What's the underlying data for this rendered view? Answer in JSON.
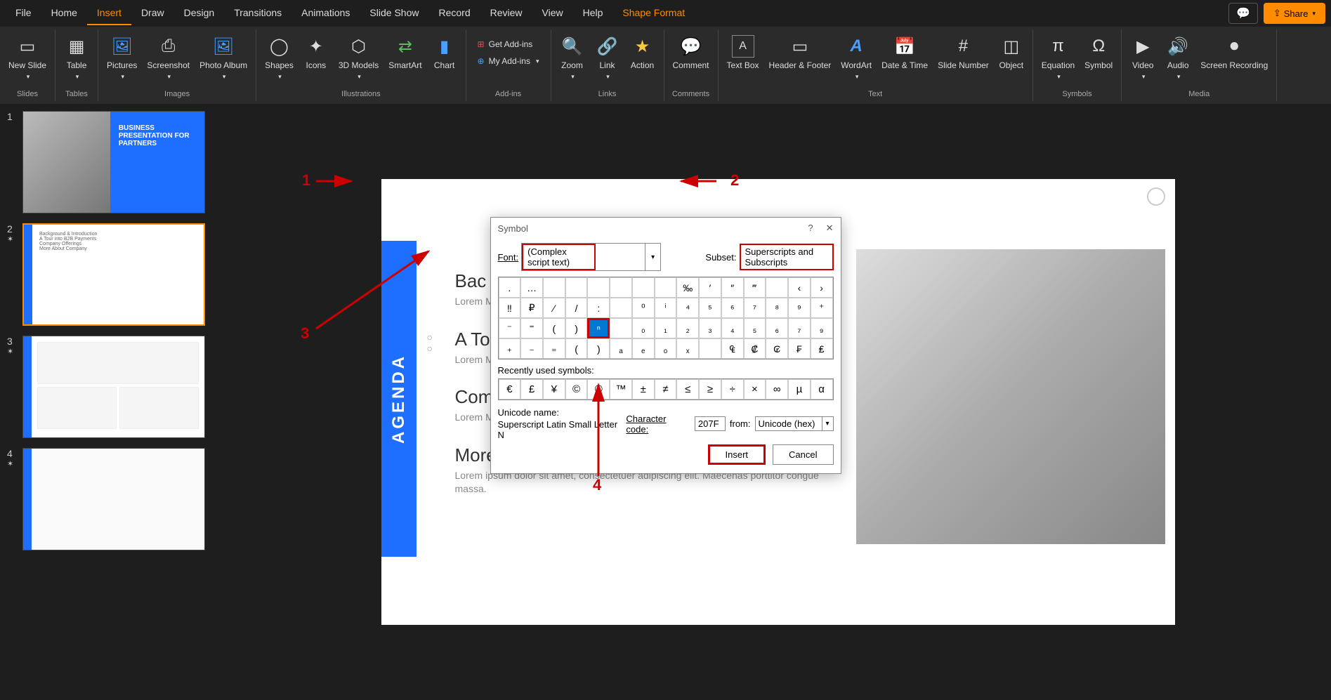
{
  "menu": {
    "items": [
      "File",
      "Home",
      "Insert",
      "Draw",
      "Design",
      "Transitions",
      "Animations",
      "Slide Show",
      "Record",
      "Review",
      "View",
      "Help",
      "Shape Format"
    ],
    "active": "Insert",
    "share": "Share"
  },
  "ribbon": {
    "groups": [
      {
        "label": "Slides",
        "buttons": [
          {
            "name": "New Slide",
            "icon": "▭⁺"
          }
        ]
      },
      {
        "label": "Tables",
        "buttons": [
          {
            "name": "Table",
            "icon": "▦"
          }
        ]
      },
      {
        "label": "Images",
        "buttons": [
          {
            "name": "Pictures",
            "icon": "🖼"
          },
          {
            "name": "Screenshot",
            "icon": "⎙"
          },
          {
            "name": "Photo Album",
            "icon": "🖼"
          }
        ]
      },
      {
        "label": "Illustrations",
        "buttons": [
          {
            "name": "Shapes",
            "icon": "○"
          },
          {
            "name": "Icons",
            "icon": "✦"
          },
          {
            "name": "3D Models",
            "icon": "⬢"
          },
          {
            "name": "SmartArt",
            "icon": "⇄"
          },
          {
            "name": "Chart",
            "icon": "📊"
          }
        ]
      },
      {
        "label": "Add-ins",
        "small": [
          {
            "name": "Get Add-ins",
            "icon": "⊞"
          },
          {
            "name": "My Add-ins",
            "icon": "⊕"
          }
        ]
      },
      {
        "label": "Links",
        "buttons": [
          {
            "name": "Zoom",
            "icon": "🔍"
          },
          {
            "name": "Link",
            "icon": "🔗"
          },
          {
            "name": "Action",
            "icon": "★"
          }
        ]
      },
      {
        "label": "Comments",
        "buttons": [
          {
            "name": "Comment",
            "icon": "💬"
          }
        ]
      },
      {
        "label": "Text",
        "buttons": [
          {
            "name": "Text Box",
            "icon": "A"
          },
          {
            "name": "Header & Footer",
            "icon": "▭"
          },
          {
            "name": "WordArt",
            "icon": "A"
          },
          {
            "name": "Date & Time",
            "icon": "📅"
          },
          {
            "name": "Slide Number",
            "icon": "#"
          },
          {
            "name": "Object",
            "icon": "◫"
          }
        ]
      },
      {
        "label": "Symbols",
        "buttons": [
          {
            "name": "Equation",
            "icon": "π"
          },
          {
            "name": "Symbol",
            "icon": "Ω"
          }
        ]
      },
      {
        "label": "Media",
        "buttons": [
          {
            "name": "Video",
            "icon": "▶"
          },
          {
            "name": "Audio",
            "icon": "🔊"
          },
          {
            "name": "Screen Recording",
            "icon": "⏺"
          }
        ]
      }
    ]
  },
  "slides_panel": {
    "thumbs": [
      {
        "num": "1",
        "star": false,
        "title": "BUSINESS PRESENTATION FOR PARTNERS"
      },
      {
        "num": "2",
        "star": true,
        "selected": true,
        "items": [
          "Background & Introduction",
          "A Tour into B2B Payments",
          "Company Offerings",
          "More About Company"
        ]
      },
      {
        "num": "3",
        "star": true
      },
      {
        "num": "4",
        "star": true
      }
    ]
  },
  "slide": {
    "agenda_label": "AGENDA",
    "sections": [
      {
        "title": "Bac",
        "text": "Lorem\nMaece"
      },
      {
        "title": "A To",
        "text": "Lorem\nMaece"
      },
      {
        "title": "Com",
        "text": "Lorem\nMaecenas porttitor congue massa."
      },
      {
        "title": "More About Company",
        "text": "Lorem ipsum dolor sit amet, consectetuer adipiscing elit.\nMaecenas porttitor congue massa."
      }
    ]
  },
  "dialog": {
    "title": "Symbol",
    "font_label": "Font:",
    "font_value": "(Complex script text)",
    "subset_label": "Subset:",
    "subset_value": "Superscripts and Subscripts",
    "grid": [
      [
        ".",
        "…",
        "",
        "",
        "",
        "",
        "",
        "",
        "‰",
        "′",
        "″",
        "‴",
        "",
        "‹",
        "›"
      ],
      [
        "‼",
        "₽",
        "⁄",
        "/",
        ":",
        "",
        "⁰",
        "ⁱ",
        "⁴",
        "⁵",
        "⁶",
        "⁷",
        "⁸",
        "⁹",
        "⁺"
      ],
      [
        "⁻",
        "⁼",
        "(",
        ")",
        "ⁿ",
        "",
        "₀",
        "₁",
        "₂",
        "₃",
        "₄",
        "₅",
        "₆",
        "₇",
        "₉"
      ],
      [
        "₊",
        "₋",
        "₌",
        "(",
        ")",
        "ₐ",
        "ₑ",
        "ₒ",
        "ₓ",
        "",
        "₠",
        "₡",
        "₢",
        "₣",
        "₤"
      ]
    ],
    "selected_cell": {
      "row": 2,
      "col": 4
    },
    "recent_label": "Recently used symbols:",
    "recent": [
      "€",
      "£",
      "¥",
      "©",
      "®",
      "™",
      "±",
      "≠",
      "≤",
      "≥",
      "÷",
      "×",
      "∞",
      "µ",
      "α"
    ],
    "unicode_name_label": "Unicode name:",
    "unicode_name": "Superscript Latin Small Letter N",
    "char_code_label": "Character code:",
    "char_code": "207F",
    "from_label": "from:",
    "from_value": "Unicode (hex)",
    "insert_btn": "Insert",
    "cancel_btn": "Cancel"
  },
  "annotations": {
    "a1": "1",
    "a2": "2",
    "a3": "3",
    "a4": "4"
  }
}
